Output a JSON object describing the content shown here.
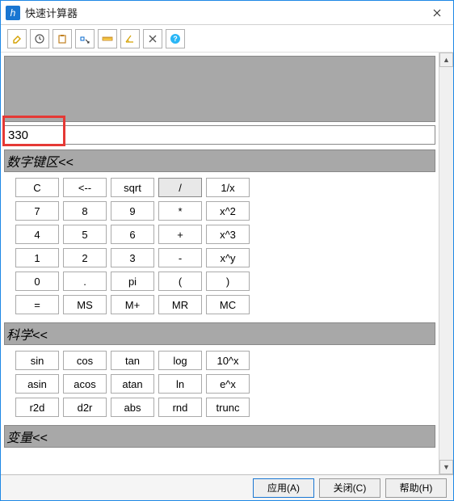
{
  "titlebar": {
    "title": "快速计算器"
  },
  "toolbar": {
    "btn1": "eraser-icon",
    "btn2": "clock-icon",
    "btn3": "paste-icon",
    "btn4": "cursor-icon",
    "btn5": "ruler-icon",
    "btn6": "angle-icon",
    "btn7": "close-tool-icon",
    "btn8": "help-icon"
  },
  "input": {
    "value": "330"
  },
  "sections": {
    "numpad": {
      "title": "数字键区<<",
      "keys": [
        "C",
        "<--",
        "sqrt",
        "/",
        "1/x",
        "7",
        "8",
        "9",
        "*",
        "x^2",
        "4",
        "5",
        "6",
        "+",
        "x^3",
        "1",
        "2",
        "3",
        "-",
        "x^y",
        "0",
        ".",
        "pi",
        "(",
        ")",
        "=",
        "MS",
        "M+",
        "MR",
        "MC"
      ],
      "active_index": 3
    },
    "science": {
      "title": "科学<<",
      "keys": [
        "sin",
        "cos",
        "tan",
        "log",
        "10^x",
        "asin",
        "acos",
        "atan",
        "ln",
        "e^x",
        "r2d",
        "d2r",
        "abs",
        "rnd",
        "trunc"
      ]
    },
    "variables": {
      "title": "变量<<"
    }
  },
  "footer": {
    "apply": "应用(A)",
    "close": "关闭(C)",
    "help": "帮助(H)"
  }
}
